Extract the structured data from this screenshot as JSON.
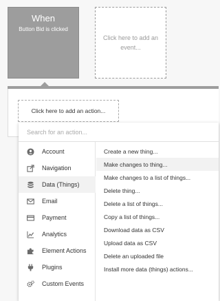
{
  "event": {
    "title": "When",
    "subtitle": "Button Bid is clicked"
  },
  "add_event": {
    "label": "Click here to add an event..."
  },
  "add_action": {
    "label": "Click here to add an action..."
  },
  "search": {
    "placeholder": "Search for an action..."
  },
  "categories": [
    {
      "label": "Account",
      "icon": "account-icon"
    },
    {
      "label": "Navigation",
      "icon": "navigation-icon"
    },
    {
      "label": "Data (Things)",
      "icon": "database-icon"
    },
    {
      "label": "Email",
      "icon": "email-icon"
    },
    {
      "label": "Payment",
      "icon": "payment-icon"
    },
    {
      "label": "Analytics",
      "icon": "analytics-icon"
    },
    {
      "label": "Element Actions",
      "icon": "puzzle-icon"
    },
    {
      "label": "Plugins",
      "icon": "plug-icon"
    },
    {
      "label": "Custom Events",
      "icon": "gears-icon"
    }
  ],
  "items": [
    "Create a new thing...",
    "Make changes to thing...",
    "Make changes to a list of things...",
    "Delete thing...",
    "Delete a list of things...",
    "Copy a list of things...",
    "Download data as CSV",
    "Upload data as CSV",
    "Delete an uploaded file",
    "Install more data (things) actions..."
  ],
  "colors": {
    "event_card": "#9d9d9d",
    "active_row": "#f2f2f2"
  }
}
